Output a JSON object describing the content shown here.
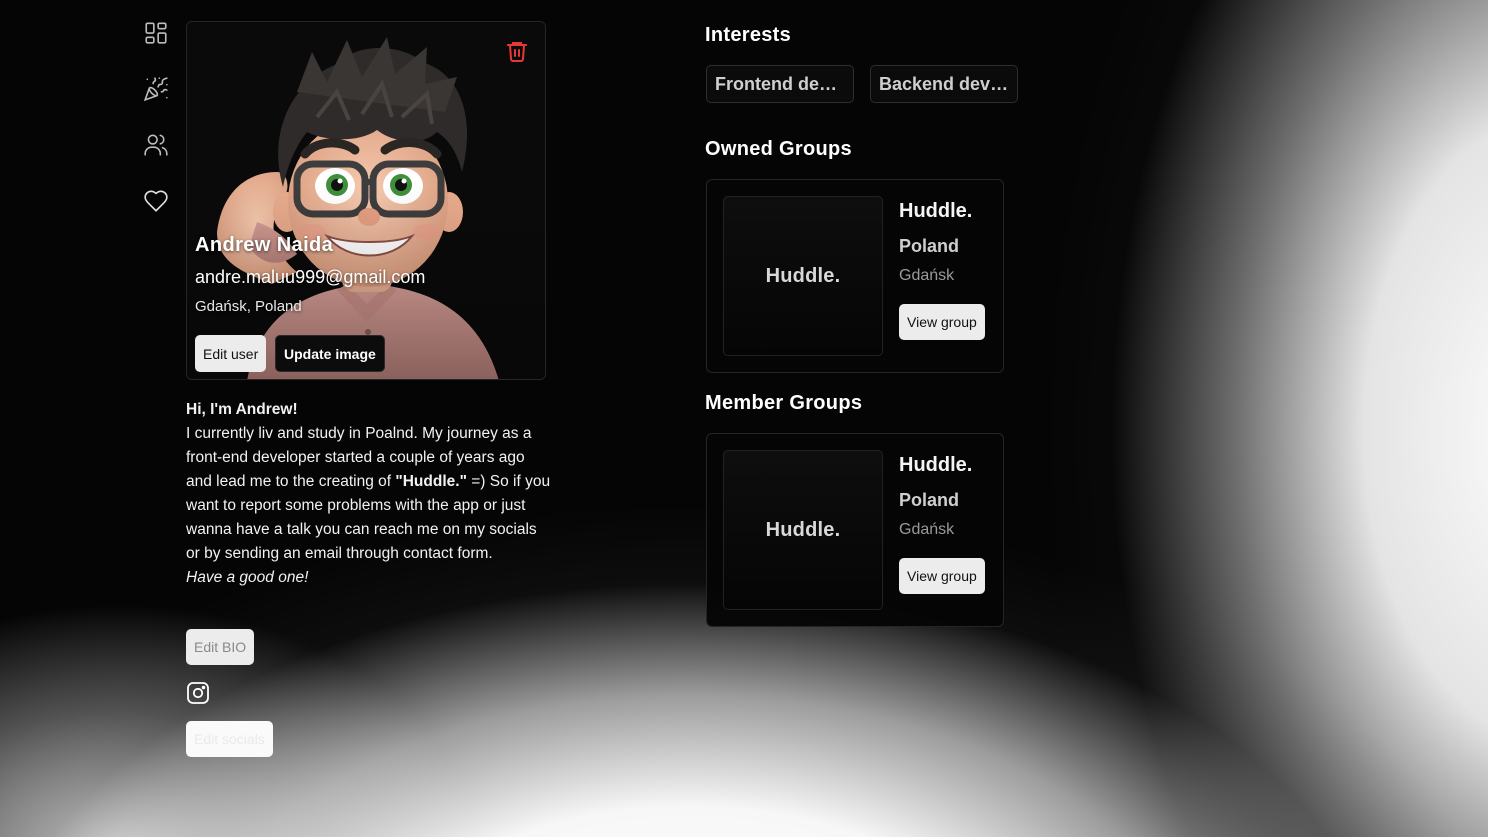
{
  "sidebar": {
    "items": [
      {
        "icon": "dashboard-grid-icon"
      },
      {
        "icon": "party-popper-icon"
      },
      {
        "icon": "users-icon"
      },
      {
        "icon": "heart-icon"
      }
    ]
  },
  "profile": {
    "name": "Andrew Naida",
    "email": "andre.maluu999@gmail.com",
    "location": "Gdańsk, Poland",
    "edit_user_label": "Edit user",
    "update_image_label": "Update image",
    "delete_icon": "trash-icon",
    "delete_icon_color": "#e53935"
  },
  "bio": {
    "greeting": "Hi, I'm Andrew!",
    "text_part1": "I currently liv and study in Poalnd. My journey as a front-end developer started a couple of years ago and lead me to the creating of ",
    "text_bold": "\"Huddle.\"",
    "text_part2": " =) So if you want to report some problems with the app or just wanna have a talk you can reach me on my socials or by sending an email through contact form.",
    "signoff": "Have a good one!",
    "edit_bio_label": "Edit BIO",
    "social_icon": "instagram-icon",
    "edit_socials_label": "Edit socials"
  },
  "interests": {
    "title": "Interests",
    "items": [
      "Frontend development",
      "Backend development"
    ]
  },
  "owned_groups": {
    "title": "Owned Groups",
    "items": [
      {
        "logo_text": "Huddle.",
        "name": "Huddle.",
        "country": "Poland",
        "city": "Gdańsk",
        "view_label": "View group"
      }
    ]
  },
  "member_groups": {
    "title": "Member Groups",
    "items": [
      {
        "logo_text": "Huddle.",
        "name": "Huddle.",
        "country": "Poland",
        "city": "Gdańsk",
        "view_label": "View group"
      }
    ]
  }
}
